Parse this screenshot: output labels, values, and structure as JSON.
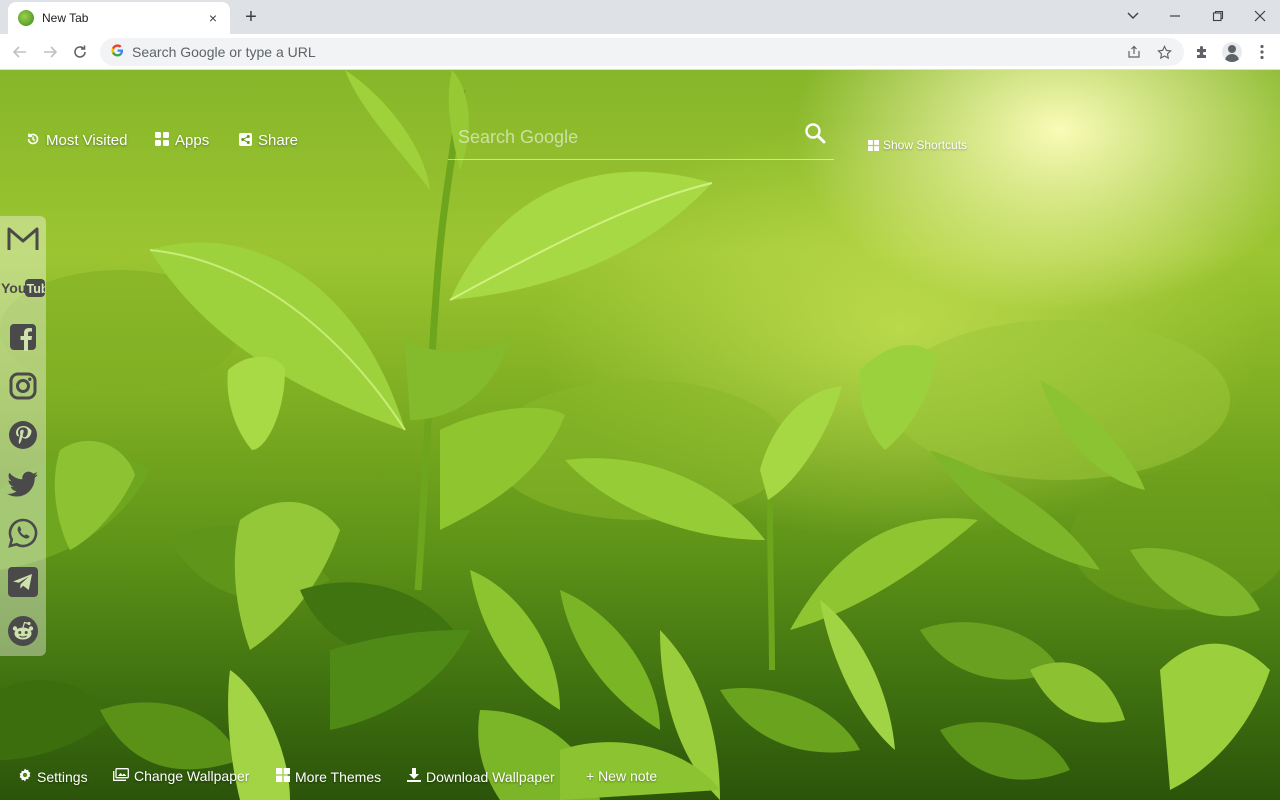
{
  "browser": {
    "tab_title": "New Tab",
    "tab_close": "×",
    "new_tab": "+",
    "omnibox_placeholder": "Search Google or type a URL",
    "window_controls": [
      "chevron-down-icon",
      "minimize-icon",
      "restore-icon",
      "close-icon"
    ]
  },
  "topnav": {
    "most_visited": "Most Visited",
    "apps": "Apps",
    "share": "Share"
  },
  "search": {
    "placeholder": "Search Google"
  },
  "shortcuts": {
    "label": "Show Shortcuts"
  },
  "social": [
    "gmail-icon",
    "youtube-icon",
    "facebook-icon",
    "instagram-icon",
    "pinterest-icon",
    "twitter-icon",
    "whatsapp-icon",
    "telegram-icon",
    "reddit-icon"
  ],
  "footer": {
    "settings": "Settings",
    "change_wallpaper": "Change Wallpaper",
    "more_themes": "More Themes",
    "download_wallpaper": "Download Wallpaper",
    "new_note": "+ New note"
  },
  "colors": {
    "chrome_bg": "#dee1e6",
    "wallpaper_light": "#c8e05a",
    "wallpaper_dark": "#2b540a"
  }
}
